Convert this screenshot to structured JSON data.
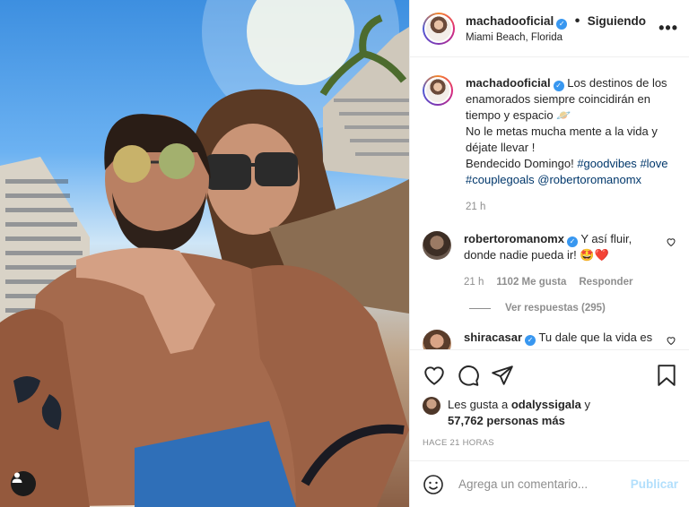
{
  "post": {
    "username": "machadooficial",
    "following": "Siguiendo",
    "separator": "•",
    "location": "Miami Beach, Florida",
    "more_icon": "more-horizontal-icon"
  },
  "caption": {
    "username": "machadooficial",
    "text": "Los destinos de los enamorados siempre coincidirán en tiempo y espacio 🪐",
    "line2": "No le metas mucha mente a la vida y déjate llevar !",
    "line3": "Bendecido Domingo! ",
    "tags": [
      "#goodvibes",
      "#love",
      "#couplegoals",
      "@robertoromanomx"
    ],
    "age": "21 h"
  },
  "comments": [
    {
      "username": "robertoromanomx",
      "text": "Y así fluir, donde nadie pueda ir! 🤩❤️",
      "age": "21 h",
      "likes": "1102 Me gusta",
      "reply": "Responder",
      "view_replies": "Ver respuestas (295)"
    },
    {
      "username": "shiracasar",
      "text": "Tu dale que la vida es"
    }
  ],
  "likes": {
    "prefix": "Les gusta a ",
    "user": "odalyssigala",
    "suffix": " y",
    "count": "57,762 personas más"
  },
  "timestamp": "HACE 21 HORAS",
  "add_comment": {
    "placeholder": "Agrega un comentario...",
    "post_label": "Publicar"
  },
  "colors": {
    "link": "#00376b",
    "verified": "#3897f0",
    "muted": "#8e8e8e",
    "post_disabled": "#b2dffc"
  }
}
